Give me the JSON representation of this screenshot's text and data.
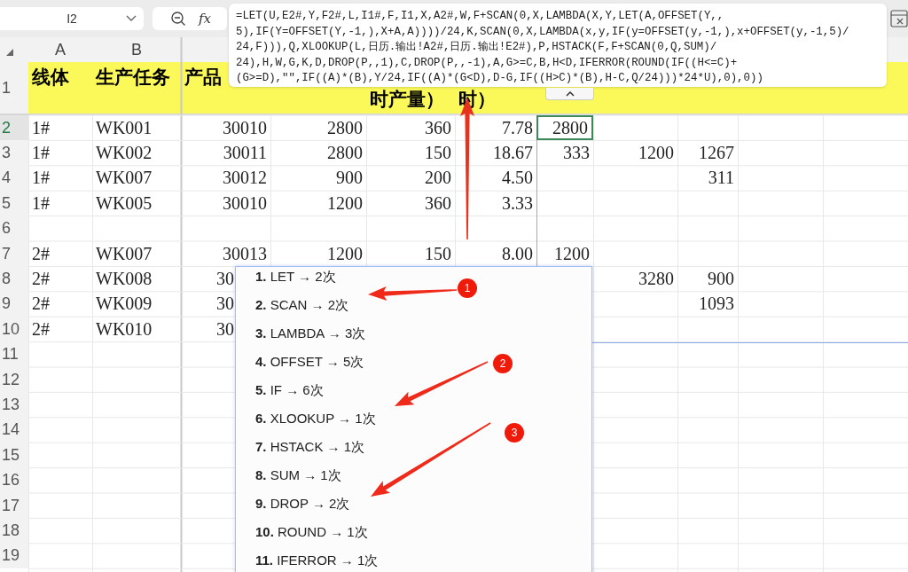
{
  "name_box": {
    "value": "I2"
  },
  "formula_bar": {
    "fx_label": "fx",
    "lines": [
      "=LET(U,E2#,Y,F2#,L,I1#,F,I1,X,A2#,W,F+SCAN(0,X,LAMBDA(X,Y,LET(A,OFFSET(Y,,",
      "5),IF(Y=OFFSET(Y,-1,),X+A,A))))/24,K,SCAN(0,X,LAMBDA(x,y,IF(y=OFFSET(y,-1,),x+OFFSET(y,-1,5)/",
      "24,F))),Q,XLOOKUP(L,日历.输出!A2#,日历.输出!E2#),P,HSTACK(F,F+SCAN(0,Q,SUM)/",
      "24),H,W,G,K,D,DROP(P,,1),C,DROP(P,,-1),A,G>=C,B,H<D,IFERROR(ROUND(IF((H<=C)+",
      "(G>=D),\"\",IF((A)*(B),Y/24,IF((A)*(G<D),D-G,IF((H>C)*(B),H-C,Q/24)))*24*U),0),0))"
    ],
    "expanded": true
  },
  "grid": {
    "columns": [
      "A",
      "B"
    ],
    "header_row": {
      "number": "1",
      "cells": [
        "线体",
        "生产任务",
        "产品"
      ],
      "second_line": [
        "时产量）",
        "时）"
      ]
    },
    "rows": [
      {
        "number": "2",
        "selected": true,
        "cells": [
          "1#",
          "WK001",
          "30010",
          "2800",
          "360",
          "7.78",
          {
            "text": "2800",
            "selected": true
          },
          "",
          "",
          "",
          ""
        ]
      },
      {
        "number": "3",
        "selected": false,
        "cells": [
          "1#",
          "WK002",
          "30011",
          "2800",
          "150",
          "18.67",
          "333",
          "1200",
          "1267",
          "",
          ""
        ]
      },
      {
        "number": "4",
        "selected": false,
        "cells": [
          "1#",
          "WK007",
          "30012",
          "900",
          "200",
          "4.50",
          "",
          "",
          "311",
          "",
          ""
        ]
      },
      {
        "number": "5",
        "selected": false,
        "cells": [
          "1#",
          "WK005",
          "30010",
          "1200",
          "360",
          "3.33",
          "",
          "",
          "",
          "",
          ""
        ]
      },
      {
        "number": "6",
        "selected": false,
        "cells": [
          "",
          "",
          "",
          "",
          "",
          "",
          "",
          "",
          "",
          "",
          ""
        ]
      },
      {
        "number": "7",
        "selected": false,
        "cells": [
          "2#",
          "WK007",
          "30013",
          "1200",
          "150",
          "8.00",
          "1200",
          "",
          "",
          "",
          ""
        ]
      },
      {
        "number": "8",
        "selected": false,
        "cells": [
          "2#",
          "WK008",
          "30",
          "",
          "",
          "",
          "",
          "3280",
          "900",
          "",
          ""
        ]
      },
      {
        "number": "9",
        "selected": false,
        "cells": [
          "2#",
          "WK009",
          "30",
          "",
          "",
          "",
          "",
          "",
          "1093",
          "",
          ""
        ]
      },
      {
        "number": "10",
        "selected": false,
        "cells": [
          "2#",
          "WK010",
          "30",
          "",
          "",
          "",
          "",
          "",
          "",
          "",
          ""
        ]
      },
      {
        "number": "11",
        "selected": false,
        "cells": [
          "",
          "",
          "",
          "",
          "",
          "",
          "",
          "",
          "",
          "",
          ""
        ]
      },
      {
        "number": "12",
        "selected": false,
        "cells": [
          "",
          "",
          "",
          "",
          "",
          "",
          "",
          "",
          "",
          "",
          ""
        ]
      },
      {
        "number": "13",
        "selected": false,
        "cells": [
          "",
          "",
          "",
          "",
          "",
          "",
          "",
          "",
          "",
          "",
          ""
        ]
      },
      {
        "number": "14",
        "selected": false,
        "cells": [
          "",
          "",
          "",
          "",
          "",
          "",
          "",
          "",
          "",
          "",
          ""
        ]
      },
      {
        "number": "15",
        "selected": false,
        "cells": [
          "",
          "",
          "",
          "",
          "",
          "",
          "",
          "",
          "",
          "",
          ""
        ]
      },
      {
        "number": "16",
        "selected": false,
        "cells": [
          "",
          "",
          "",
          "",
          "",
          "",
          "",
          "",
          "",
          "",
          ""
        ]
      },
      {
        "number": "17",
        "selected": false,
        "cells": [
          "",
          "",
          "",
          "",
          "",
          "",
          "",
          "",
          "",
          "",
          ""
        ]
      },
      {
        "number": "18",
        "selected": false,
        "cells": [
          "",
          "",
          "",
          "",
          "",
          "",
          "",
          "",
          "",
          "",
          ""
        ]
      },
      {
        "number": "19",
        "selected": false,
        "cells": [
          "",
          "",
          "",
          "",
          "",
          "",
          "",
          "",
          "",
          "",
          ""
        ]
      }
    ]
  },
  "function_list": {
    "items": [
      "**1.** LET → 2次",
      "**2.** SCAN → 2次",
      "**3.** LAMBDA → 3次",
      "**4.** OFFSET → 5次",
      "**5.** IF → 6次",
      "**6.** XLOOKUP → 1次",
      "**7.** HSTACK → 1次",
      "**8.** SUM → 1次",
      "**9.** DROP → 2次",
      "**10.** ROUND → 1次",
      "**11.** IFERROR → 1次"
    ]
  },
  "annotations": [
    {
      "number": "1"
    },
    {
      "number": "2"
    },
    {
      "number": "3"
    }
  ]
}
